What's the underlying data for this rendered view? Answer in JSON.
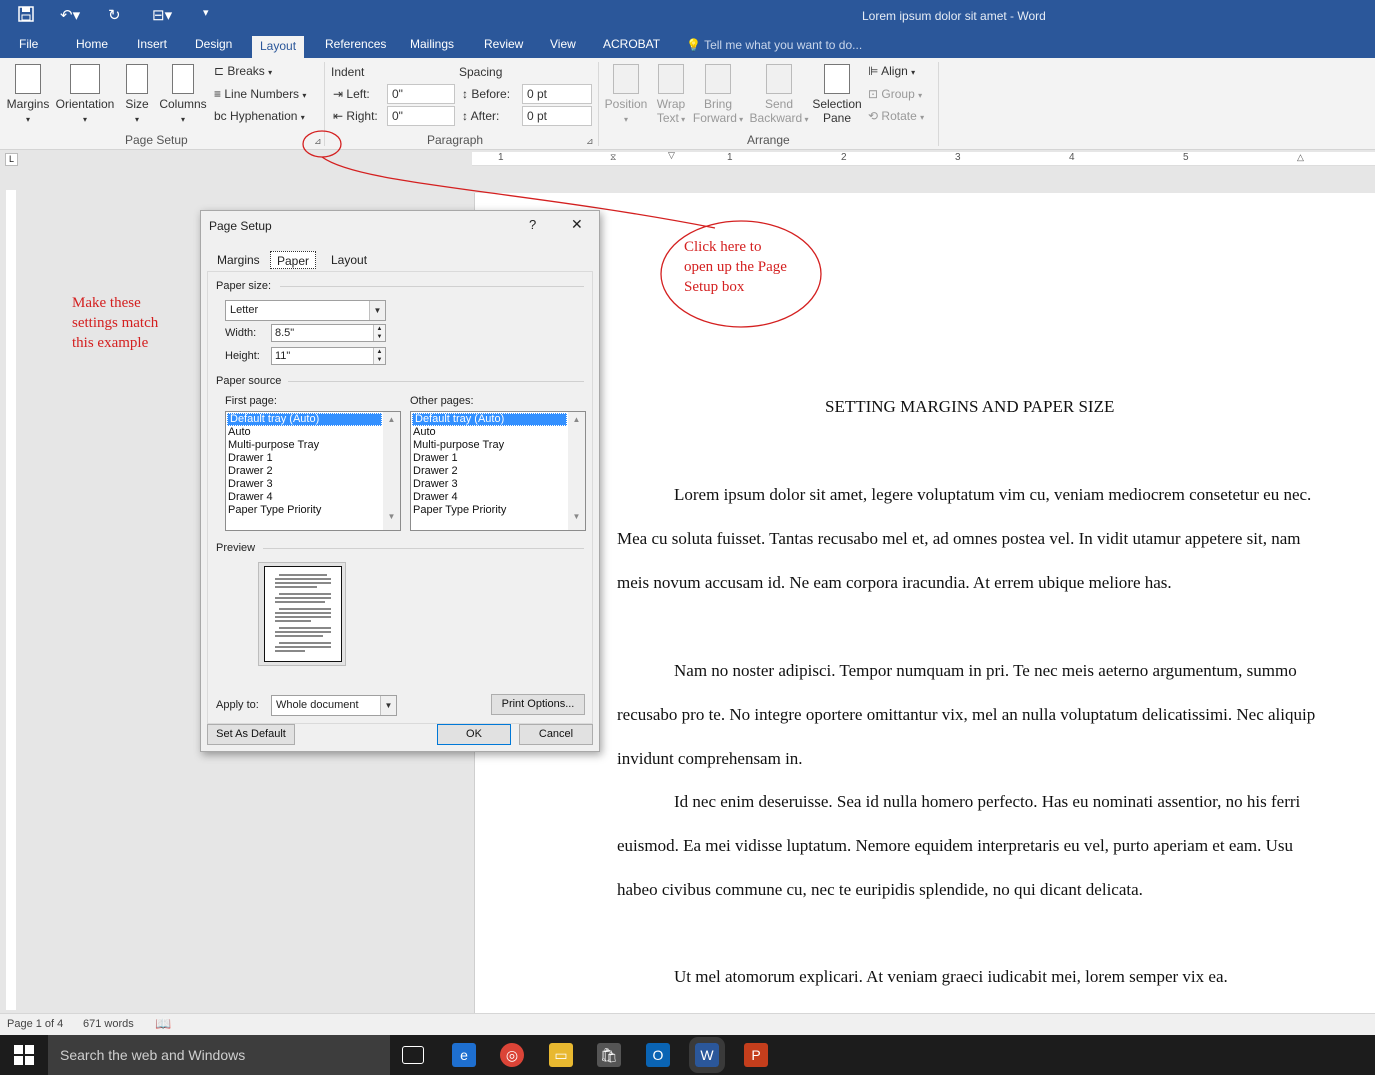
{
  "window": {
    "title": "Lorem ipsum dolor sit amet - Word"
  },
  "quick_access": {
    "save_icon": "save-icon",
    "undo_icon": "undo-icon",
    "redo_icon": "redo-icon",
    "touch_icon": "touch-mode-icon",
    "customize_icon": "customize-icon"
  },
  "tabs": [
    {
      "label": "File"
    },
    {
      "label": "Home"
    },
    {
      "label": "Insert"
    },
    {
      "label": "Design"
    },
    {
      "label": "Layout"
    },
    {
      "label": "References"
    },
    {
      "label": "Mailings"
    },
    {
      "label": "Review"
    },
    {
      "label": "View"
    },
    {
      "label": "ACROBAT"
    }
  ],
  "active_tab": "Layout",
  "tell_me": "Tell me what you want to do...",
  "ribbon": {
    "page_setup": {
      "margins": "Margins",
      "orientation": "Orientation",
      "size": "Size",
      "columns": "Columns",
      "breaks": "Breaks",
      "line_numbers": "Line Numbers",
      "hyphenation": "Hyphenation",
      "group_label": "Page Setup"
    },
    "paragraph": {
      "indent_label": "Indent",
      "spacing_label": "Spacing",
      "left_label": "Left:",
      "left_value": "0\"",
      "right_label": "Right:",
      "right_value": "0\"",
      "before_label": "Before:",
      "before_value": "0 pt",
      "after_label": "After:",
      "after_value": "0 pt",
      "group_label": "Paragraph"
    },
    "arrange": {
      "position": "Position",
      "wrap_text_1": "Wrap",
      "wrap_text_2": "Text",
      "bring_forward_1": "Bring",
      "bring_forward_2": "Forward",
      "send_backward_1": "Send",
      "send_backward_2": "Backward",
      "selection_pane_1": "Selection",
      "selection_pane_2": "Pane",
      "align": "Align",
      "group": "Group",
      "rotate": "Rotate",
      "group_label": "Arrange"
    }
  },
  "ruler": {
    "numbers": [
      "1",
      "1",
      "2",
      "3",
      "4",
      "5"
    ]
  },
  "document": {
    "heading": "SETTING MARGINS AND PAPER SIZE",
    "paragraphs": [
      "Lorem ipsum dolor sit amet, legere voluptatum vim cu, veniam mediocrem consetetur eu nec. Mea cu soluta fuisset. Tantas recusabo mel et, ad omnes postea vel. In vidit utamur appetere sit, nam meis novum accusam id. Ne eam corpora iracundia. At errem ubique meliore has.",
      "Nam no noster adipisci. Tempor numquam in pri. Te nec meis aeterno argumentum, summo recusabo pro te. No integre oportere omittantur vix, mel an nulla voluptatum delicatissimi. Nec aliquip invidunt comprehensam in.",
      "Id nec enim deseruisse. Sea id nulla homero perfecto. Has eu nominati assentior, no his ferri euismod. Ea mei vidisse luptatum. Nemore equidem interpretaris eu vel, purto aperiam et eam. Usu habeo civibus commune cu, nec te euripidis splendide, no qui dicant delicata.",
      "Ut mel atomorum explicari. At veniam graeci iudicabit mei, lorem semper vix ea."
    ]
  },
  "annotations": {
    "left_note_1": "Make these",
    "left_note_2": "settings match",
    "left_note_3": "this example",
    "callout_1": "Click here to",
    "callout_2": "open up the Page",
    "callout_3": "Setup box"
  },
  "dialog": {
    "title": "Page Setup",
    "help": "?",
    "close": "✕",
    "tabs": [
      "Margins",
      "Paper",
      "Layout"
    ],
    "selected_tab": "Paper",
    "paper_size_label": "Paper size:",
    "paper_size_value": "Letter",
    "width_label": "Width:",
    "width_value": "8.5\"",
    "height_label": "Height:",
    "height_value": "11\"",
    "paper_source_label": "Paper source",
    "first_page_label": "First page:",
    "other_pages_label": "Other pages:",
    "trays": [
      "Default tray (Auto)",
      "Auto",
      "Multi-purpose Tray",
      "Drawer 1",
      "Drawer 2",
      "Drawer 3",
      "Drawer 4",
      "Paper Type Priority"
    ],
    "preview_label": "Preview",
    "apply_to_label": "Apply to:",
    "apply_to_value": "Whole document",
    "print_options": "Print Options...",
    "set_default": "Set As Default",
    "ok": "OK",
    "cancel": "Cancel"
  },
  "status": {
    "page": "Page 1 of 4",
    "words": "671 words"
  },
  "taskbar": {
    "search_placeholder": "Search the web and Windows"
  },
  "colors": {
    "word_blue": "#2b579a",
    "annotation_red": "#d42020",
    "selection_blue": "#3390ff"
  }
}
